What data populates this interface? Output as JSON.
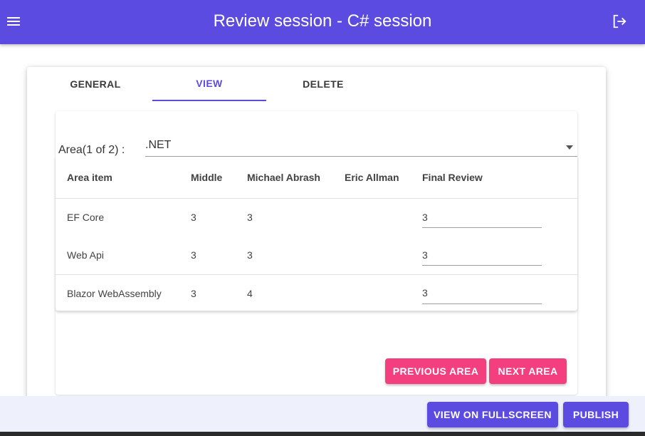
{
  "header": {
    "title": "Review session - C# session",
    "menu_icon": "menu-icon",
    "logout_icon": "logout-icon"
  },
  "tabs": [
    {
      "label": "GENERAL",
      "active": false
    },
    {
      "label": "VIEW",
      "active": true
    },
    {
      "label": "DELETE",
      "active": false
    }
  ],
  "area": {
    "label": "Area(1 of 2) :",
    "selected": ".NET"
  },
  "table": {
    "headers": [
      "Area item",
      "Middle",
      "Michael Abrash",
      "Eric Allman",
      "Final Review"
    ],
    "rows": [
      {
        "item": "EF Core",
        "middle": "3",
        "michael": "3",
        "eric": "",
        "final": "3"
      },
      {
        "item": "Web Api",
        "middle": "3",
        "michael": "3",
        "eric": "",
        "final": "3"
      },
      {
        "item": "Blazor WebAssembly",
        "middle": "3",
        "michael": "4",
        "eric": "",
        "final": "3"
      }
    ]
  },
  "buttons": {
    "previous_area": "PREVIOUS AREA",
    "next_area": "NEXT AREA",
    "view_fullscreen": "VIEW ON FULLSCREEN",
    "publish": "PUBLISH"
  },
  "colors": {
    "primary": "#5b4be0",
    "accent": "#f43f7f"
  }
}
